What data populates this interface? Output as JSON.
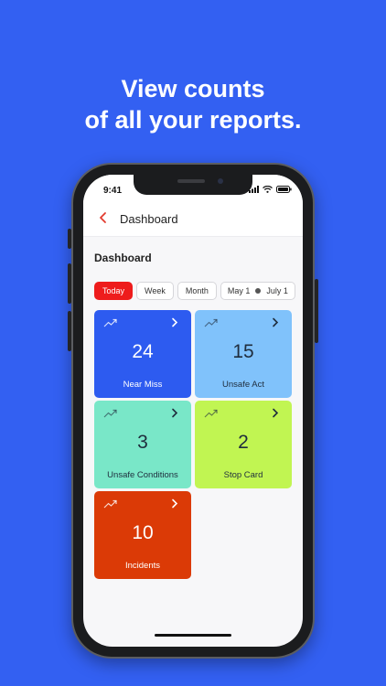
{
  "headline": {
    "line1": "View counts",
    "line2": "of all your reports."
  },
  "status_bar": {
    "time": "9:41",
    "icons": [
      "signal-icon",
      "wifi-icon",
      "battery-icon"
    ]
  },
  "app_bar": {
    "title": "Dashboard",
    "back_icon": "chevron-left-icon"
  },
  "section_title": "Dashboard",
  "filters": {
    "today": "Today",
    "week": "Week",
    "month": "Month",
    "range_start": "May 1",
    "range_end": "July 1",
    "selected": "Today"
  },
  "cards": [
    {
      "count": "24",
      "label": "Near Miss",
      "color": "#2d5bf0"
    },
    {
      "count": "15",
      "label": "Unsafe Act",
      "color": "#80c2fb"
    },
    {
      "count": "3",
      "label": "Unsafe Conditions",
      "color": "#79e7c8"
    },
    {
      "count": "2",
      "label": "Stop Card",
      "color": "#c1f552"
    },
    {
      "count": "10",
      "label": "Incidents",
      "color": "#db3a06"
    }
  ],
  "colors": {
    "background": "#3360f2",
    "accent_red": "#ee1c1c"
  }
}
